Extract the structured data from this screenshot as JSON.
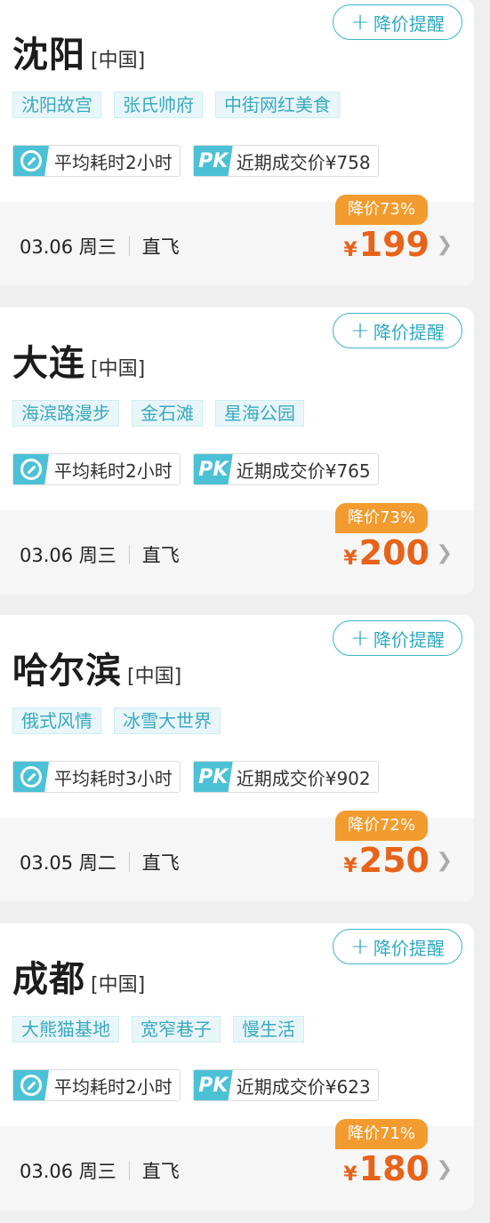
{
  "cards": [
    {
      "remind_label": "降价提醒",
      "city": "沈阳",
      "country": "[中国]",
      "tags": [
        "沈阳故宫",
        "张氏帅府",
        "中街网红美食"
      ],
      "avg_time": "平均耗时2小时",
      "pk_label": "PK",
      "recent_price": "近期成交价¥758",
      "date": "03.06 周三",
      "flight_type": "直飞",
      "discount": "降价73%",
      "currency": "¥",
      "price": "199"
    },
    {
      "remind_label": "降价提醒",
      "city": "大连",
      "country": "[中国]",
      "tags": [
        "海滨路漫步",
        "金石滩",
        "星海公园"
      ],
      "avg_time": "平均耗时2小时",
      "pk_label": "PK",
      "recent_price": "近期成交价¥765",
      "date": "03.06 周三",
      "flight_type": "直飞",
      "discount": "降价73%",
      "currency": "¥",
      "price": "200"
    },
    {
      "remind_label": "降价提醒",
      "city": "哈尔滨",
      "country": "[中国]",
      "tags": [
        "俄式风情",
        "冰雪大世界"
      ],
      "avg_time": "平均耗时3小时",
      "pk_label": "PK",
      "recent_price": "近期成交价¥902",
      "date": "03.05 周二",
      "flight_type": "直飞",
      "discount": "降价72%",
      "currency": "¥",
      "price": "250"
    },
    {
      "remind_label": "降价提醒",
      "city": "成都",
      "country": "[中国]",
      "tags": [
        "大熊猫基地",
        "宽窄巷子",
        "慢生活"
      ],
      "avg_time": "平均耗时2小时",
      "pk_label": "PK",
      "recent_price": "近期成交价¥623",
      "date": "03.06 周三",
      "flight_type": "直飞",
      "discount": "降价71%",
      "currency": "¥",
      "price": "180"
    }
  ]
}
